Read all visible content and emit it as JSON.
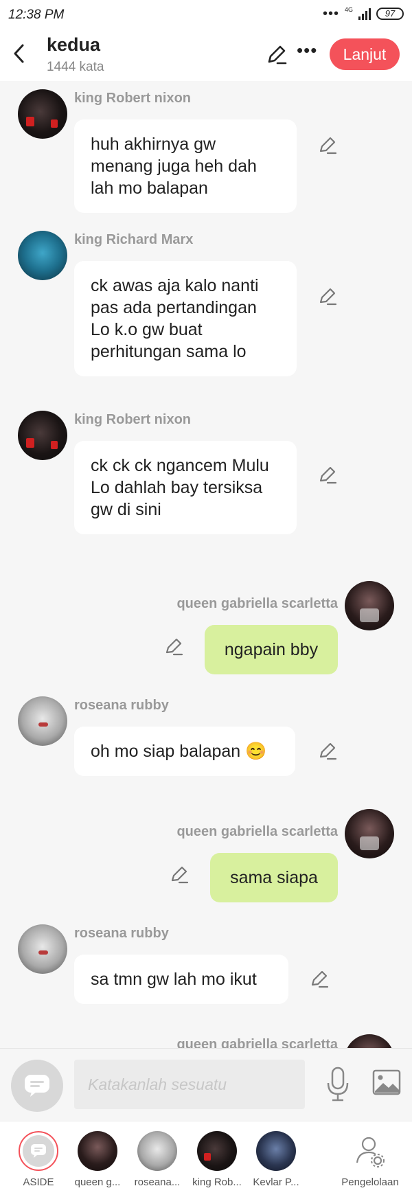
{
  "status_bar": {
    "time": "12:38 PM",
    "network": "4G",
    "battery": "97"
  },
  "header": {
    "title": "kedua",
    "word_count": "1444 kata",
    "next_button": "Lanjut"
  },
  "messages": [
    {
      "author": "king Robert nixon",
      "text": "huh akhirnya gw menang juga heh dah lah mo balapan",
      "side": "left"
    },
    {
      "author": "king Richard Marx",
      "text": "ck awas aja kalo nanti pas ada pertandingan Lo k.o gw buat perhitungan sama lo",
      "side": "left"
    },
    {
      "author": "king Robert nixon",
      "text": "ck ck ck ngancem Mulu Lo dahlah bay tersiksa gw di sini",
      "side": "left"
    },
    {
      "author": "queen gabriella scarletta",
      "text": "ngapain bby",
      "side": "right"
    },
    {
      "author": "roseana rubby",
      "text": "oh mo siap balapan 😊",
      "side": "left"
    },
    {
      "author": "queen gabriella scarletta",
      "text": "sama siapa",
      "side": "right"
    },
    {
      "author": "roseana rubby",
      "text": "sa tmn gw lah mo ikut",
      "side": "left"
    },
    {
      "author": "queen gabriella scarletta",
      "text": "",
      "side": "right"
    }
  ],
  "composer": {
    "placeholder": "Katakanlah sesuatu"
  },
  "bottom_tabs": [
    {
      "label": "ASIDE"
    },
    {
      "label": "queen g..."
    },
    {
      "label": "roseana..."
    },
    {
      "label": "king Rob..."
    },
    {
      "label": "Kevlar P..."
    },
    {
      "label": "Pengelolaan"
    }
  ],
  "colors": {
    "accent": "#f4525a",
    "right_bubble": "#d8f09e",
    "left_bubble": "#ffffff",
    "background": "#f6f6f6"
  }
}
